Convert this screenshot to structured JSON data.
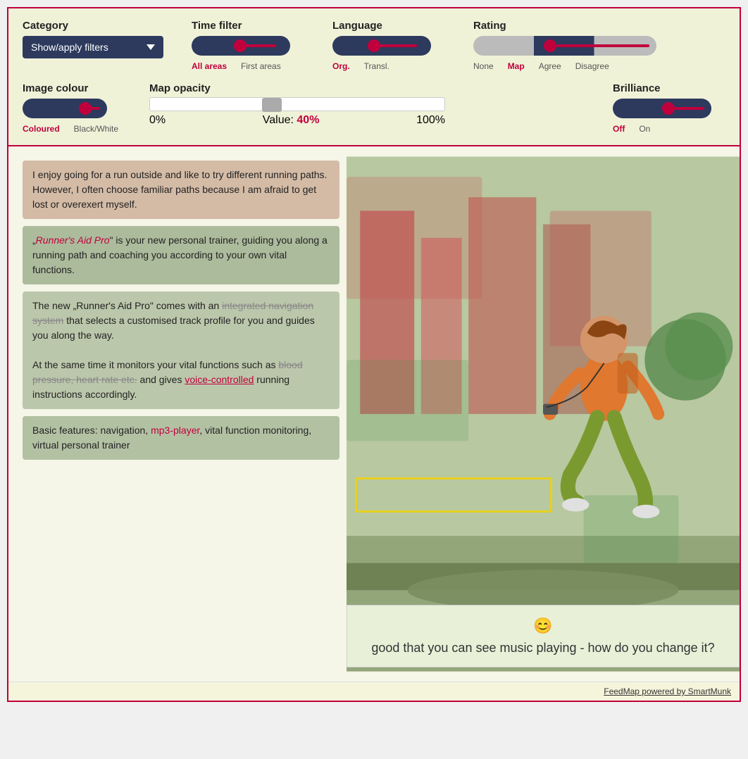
{
  "filter_bar": {
    "category": {
      "label": "Category",
      "dropdown_label": "Show/apply filters"
    },
    "time_filter": {
      "label": "Time filter",
      "sublabels": [
        "All areas",
        "First areas"
      ],
      "active": "All areas"
    },
    "language": {
      "label": "Language",
      "sublabels": [
        "Org.",
        "Transl."
      ],
      "active": "Org."
    },
    "rating": {
      "label": "Rating",
      "sublabels": [
        "None",
        "Map",
        "Agree",
        "Disagree"
      ],
      "active": "Map"
    },
    "image_colour": {
      "label": "Image colour",
      "sublabels": [
        "Coloured",
        "Black/White"
      ],
      "active": "Coloured"
    },
    "map_opacity": {
      "label": "Map opacity",
      "min_label": "0%",
      "value_label": "Value:",
      "value": "40%",
      "max_label": "100%"
    },
    "brilliance": {
      "label": "Brilliance",
      "sublabels": [
        "Off",
        "On"
      ]
    }
  },
  "text_blocks": [
    {
      "id": 1,
      "text": "I enjoy going for a run outside and like to try different running paths. However, I often choose familiar paths because I am afraid to get lost or overexert myself."
    },
    {
      "id": 2,
      "text": "\"Runner's Aid Pro\" is your new personal trainer, guiding you along a running path and coaching you according to your own vital functions."
    },
    {
      "id": 3,
      "text": "The new \"Runner's Aid Pro\" comes with an integrated navigation system that selects a customised track profile for you and guides you along the way.\n\nAt the same time it monitors your vital functions such as blood pressure, heart rate etc. and gives voice-controlled running instructions accordingly."
    },
    {
      "id": 4,
      "text": "Basic features: navigation, mp3-player, vital function monitoring, virtual personal trainer"
    }
  ],
  "tooltip": {
    "face": "ü",
    "text": "good that you can see music playing - how do you change it?"
  },
  "footer": {
    "text": "FeedMap powered by SmartMunk"
  }
}
